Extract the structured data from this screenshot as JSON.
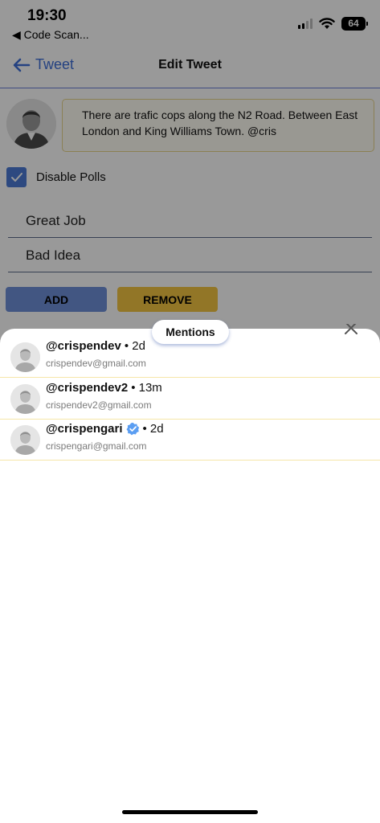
{
  "status_bar": {
    "time": "19:30",
    "back_app": "◀ Code Scan...",
    "battery": "64"
  },
  "nav": {
    "back_label": "Tweet",
    "title": "Edit Tweet"
  },
  "tweet": {
    "text": "There are trafic cops along the N2 Road. Between East London and King Williams Town. @cris"
  },
  "polls": {
    "disable_label": "Disable Polls",
    "disabled": true,
    "options": [
      "Great Job",
      "Bad Idea"
    ],
    "add_label": "ADD",
    "remove_label": "REMOVE"
  },
  "mentions": {
    "title": "Mentions",
    "items": [
      {
        "handle": "@crispendev",
        "time": "• 2d",
        "email": "crispendev@gmail.com",
        "verified": false
      },
      {
        "handle": "@crispendev2",
        "time": "• 13m",
        "email": "crispendev2@gmail.com",
        "verified": false
      },
      {
        "handle": "@crispengari",
        "time": "• 2d",
        "email": "crispengari@gmail.com",
        "verified": true
      }
    ]
  },
  "colors": {
    "accent": "#3f6fd8",
    "add_button": "#6f8fd9",
    "remove_button": "#f4c542",
    "row_divider": "#f6e6a8"
  },
  "icons": {
    "back": "arrow-left-icon",
    "checkbox": "checkmark-icon",
    "verified": "verified-badge-icon",
    "close": "close-icon",
    "avatar": "user-avatar-icon",
    "wifi": "wifi-icon",
    "signal": "cellular-signal-icon",
    "battery": "battery-icon"
  }
}
